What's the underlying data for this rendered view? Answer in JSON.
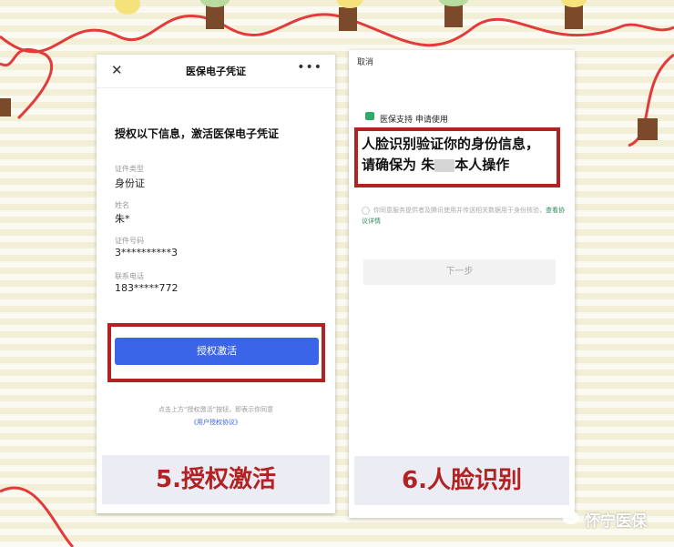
{
  "colors": {
    "accent_blue": "#3a65e8",
    "highlight_red": "#b22222",
    "wechat_green": "#2aae67"
  },
  "left_panel": {
    "title": "医保电子凭证",
    "close_icon": "close-icon",
    "more_icon": "more-icon",
    "heading": "授权以下信息，激活医保电子凭证",
    "fields": [
      {
        "label": "证件类型",
        "value": "身份证"
      },
      {
        "label": "姓名",
        "value": "朱*"
      },
      {
        "label": "证件号码",
        "value": "3**********3"
      },
      {
        "label": "联系电话",
        "value": "183*****772"
      }
    ],
    "activate_button": "授权激活",
    "agreement_line1": "点击上方“授权激活”按钮，即表示你同意",
    "agreement_link": "《用户授权协议》",
    "step_banner": "5.授权激活"
  },
  "right_panel": {
    "cancel": "取消",
    "support_text": "医保支持 申请使用",
    "face_line1": "人脸识别验证你的身份信息，",
    "face_line2_a": "请确保为 朱",
    "face_line2_b": "本人操作",
    "consent_text": "你同意服务提供者及腾讯使用并传送相关数据用于身份核验，",
    "consent_link": "查看协议详情",
    "next_button": "下一步",
    "step_banner": "6.人脸识别"
  },
  "watermark": "怀宁医保"
}
